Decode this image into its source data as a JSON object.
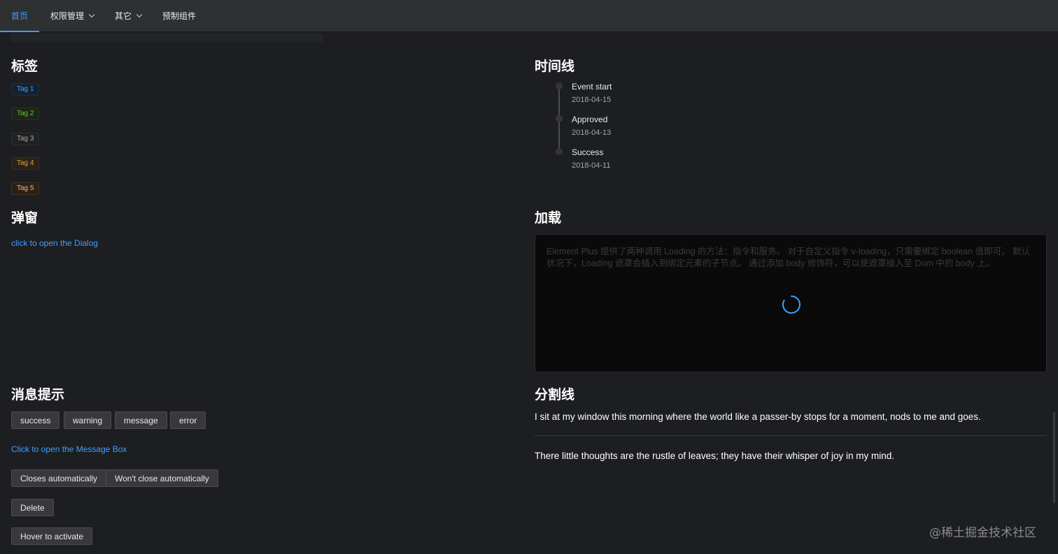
{
  "nav": {
    "items": [
      {
        "label": "首页",
        "active": true,
        "dropdown": false
      },
      {
        "label": "权限管理",
        "active": false,
        "dropdown": true
      },
      {
        "label": "其它",
        "active": false,
        "dropdown": true
      },
      {
        "label": "预制组件",
        "active": false,
        "dropdown": false
      }
    ]
  },
  "tags_section": {
    "title": "标签",
    "tags": [
      {
        "label": "Tag 1",
        "type": "primary"
      },
      {
        "label": "Tag 2",
        "type": "success"
      },
      {
        "label": "Tag 3",
        "type": "info"
      },
      {
        "label": "Tag 4",
        "type": "warning"
      },
      {
        "label": "Tag 5",
        "type": "orange"
      }
    ]
  },
  "dialog_section": {
    "title": "弹窗",
    "link": "click to open the Dialog"
  },
  "message_section": {
    "title": "消息提示",
    "buttons": [
      "success",
      "warning",
      "message",
      "error"
    ],
    "message_box_link": "Click to open the Message Box",
    "notify_buttons": [
      "Closes automatically",
      "Won't close automatically"
    ],
    "delete_button": "Delete",
    "hover_button": "Hover to activate"
  },
  "timeline_section": {
    "title": "时间线",
    "events": [
      {
        "title": "Event start",
        "time": "2018-04-15"
      },
      {
        "title": "Approved",
        "time": "2018-04-13"
      },
      {
        "title": "Success",
        "time": "2018-04-11"
      }
    ]
  },
  "loading_section": {
    "title": "加载",
    "text": "Element Plus 提供了两种调用 Loading 的方法：指令和服务。 对于自定义指令 v-loading，只需要绑定 boolean 值即可。 默认状况下，Loading 遮罩会插入到绑定元素的子节点。 通过添加 body 修饰符，可以使遮罩插入至 Dom 中的 body 上。"
  },
  "divider_section": {
    "title": "分割线",
    "para1": "I sit at my window this morning where the world like a passer-by stops for a moment, nods to me and goes.",
    "para2": "There little thoughts are the rustle of leaves; they have their whisper of joy in my mind."
  },
  "watermark": "@稀土掘金技术社区",
  "colors": {
    "accent": "#409eff",
    "background": "#1d1e21",
    "topbar": "#2f3032"
  }
}
